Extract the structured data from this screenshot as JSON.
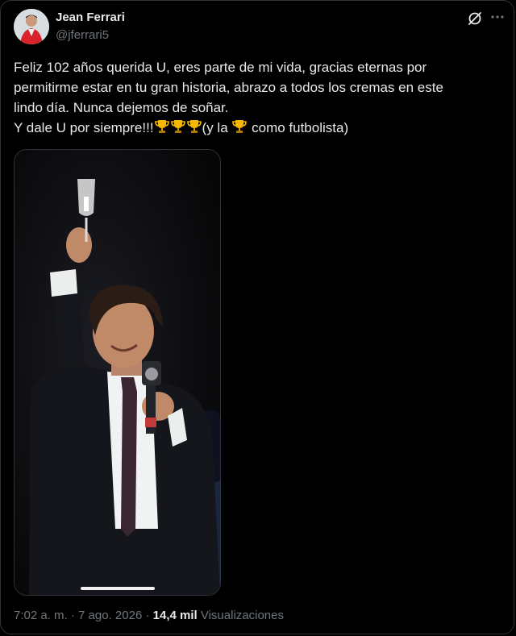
{
  "author": {
    "name": "Jean Ferrari",
    "handle": "@jferrari5"
  },
  "tweet": {
    "line1": "Feliz 102 años querida U, eres parte de mi vida, gracias eternas por",
    "line2": "permitirme estar en tu gran historia, abrazo a todos los cremas en este",
    "line3": "lindo día. Nunca dejemos de soñar.",
    "line4_start": "Y dale U por siempre!!!",
    "line4_mid": "(y la ",
    "line4_end": " como futbolista)"
  },
  "icons": {
    "grok": "grok-icon",
    "more": "more-icon",
    "trophy": "trophy-icon",
    "avatar": "avatar"
  },
  "colors": {
    "background": "#000000",
    "text": "#e7e9ea",
    "muted": "#71767b",
    "trophy": "#f5b700"
  },
  "meta": {
    "time": "7:02 a. m.",
    "separator": " · ",
    "date": "7 ago. 2026",
    "views_count": "14,4 mil",
    "views_label": "Visualizaciones"
  }
}
